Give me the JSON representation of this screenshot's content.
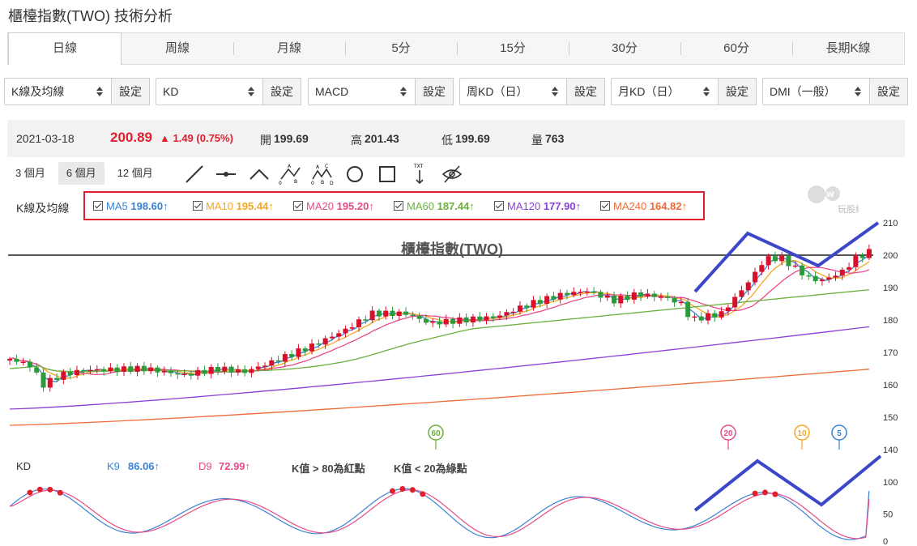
{
  "page": {
    "title": "櫃檯指數(TWO) 技術分析"
  },
  "period_tabs": [
    {
      "label": "日線",
      "active": true
    },
    {
      "label": "周線"
    },
    {
      "label": "月線"
    },
    {
      "label": "5分"
    },
    {
      "label": "15分"
    },
    {
      "label": "30分"
    },
    {
      "label": "60分"
    },
    {
      "label": "長期K線"
    }
  ],
  "selectors": [
    {
      "value": "K線及均線",
      "button": "設定"
    },
    {
      "value": "KD",
      "button": "設定"
    },
    {
      "value": "MACD",
      "button": "設定"
    },
    {
      "value": "周KD（日）",
      "button": "設定"
    },
    {
      "value": "月KD（日）",
      "button": "設定"
    },
    {
      "value": "DMI（一般）",
      "button": "設定"
    }
  ],
  "quote": {
    "date": "2021-03-18",
    "price": "200.89",
    "change": "▲ 1.49 (0.75%)",
    "open_label": "開",
    "open": "199.69",
    "high_label": "高",
    "high": "201.43",
    "low_label": "低",
    "low": "199.69",
    "volume_label": "量",
    "volume": "763"
  },
  "ranges": [
    {
      "label": "3 個月"
    },
    {
      "label": "6 個月",
      "active": true
    },
    {
      "label": "12 個月"
    }
  ],
  "tools": [
    "line-tool-icon",
    "segment-tool-icon",
    "angle-tool-icon",
    "abc-pattern-icon",
    "abcd-pattern-icon",
    "circle-tool-icon",
    "rectangle-tool-icon",
    "text-arrow-icon",
    "hide-eye-icon"
  ],
  "ma_panel": {
    "label": "K線及均線",
    "items": [
      {
        "name": "MA5",
        "value": "198.60↑",
        "color": "#3b82d6"
      },
      {
        "name": "MA10",
        "value": "195.44↑",
        "color": "#f5a623"
      },
      {
        "name": "MA20",
        "value": "195.20↑",
        "color": "#e84a8a"
      },
      {
        "name": "MA60",
        "value": "187.44↑",
        "color": "#6ab03a"
      },
      {
        "name": "MA120",
        "value": "177.90↑",
        "color": "#8a3fd6"
      },
      {
        "name": "MA240",
        "value": "164.82↑",
        "color": "#f06a35"
      }
    ]
  },
  "watermark": {
    "text": "玩股網"
  },
  "kd_panel": {
    "title": "KD",
    "k_label": "K9",
    "k_value": "86.06↑",
    "d_label": "D9",
    "d_value": "72.99↑",
    "note1": "K值 > 80為紅點",
    "note2": "K值 < 20為綠點"
  },
  "chart_data": [
    {
      "type": "candlestick",
      "title": "櫃檯指數(TWO)",
      "y_ticks": [
        "210",
        "200",
        "190",
        "180",
        "170",
        "160",
        "150",
        "140"
      ],
      "ylim": [
        140,
        210
      ],
      "grid": false,
      "reference_line": 200,
      "trend": "rise from about 165 to about 201 over six months; sideways 163–167 early, steady climb to ~184, plateau ~188–190, dip to ~178, surge to ~200, pullback to ~191, then up to ~201",
      "series": [
        {
          "name": "MA5",
          "color": "#3b82d6",
          "last": 198.6
        },
        {
          "name": "MA10",
          "color": "#f5a623",
          "last": 195.44
        },
        {
          "name": "MA20",
          "color": "#e84a8a",
          "last": 195.2
        },
        {
          "name": "MA60",
          "color": "#6ab03a",
          "last": 187.44
        },
        {
          "name": "MA120",
          "color": "#8a3fd6",
          "last": 177.9
        },
        {
          "name": "MA240",
          "color": "#f06a35",
          "last": 164.82
        }
      ],
      "markers": [
        {
          "label": "60",
          "color": "#6ab03a"
        },
        {
          "label": "20",
          "color": "#e84a8a"
        },
        {
          "label": "10",
          "color": "#f5a623"
        },
        {
          "label": "5",
          "color": "#3b82d6"
        }
      ],
      "annotations": [
        "blue hand-drawn M pattern over the most recent highs"
      ]
    },
    {
      "type": "line",
      "title": "KD",
      "y_ticks": [
        "100",
        "50",
        "0"
      ],
      "ylim": [
        0,
        100
      ],
      "series": [
        {
          "name": "K9",
          "color": "#3b82d6",
          "last": 86.06
        },
        {
          "name": "D9",
          "color": "#e84a8a",
          "last": 72.99
        }
      ],
      "overbought_dot_color": "#e0202d"
    }
  ]
}
